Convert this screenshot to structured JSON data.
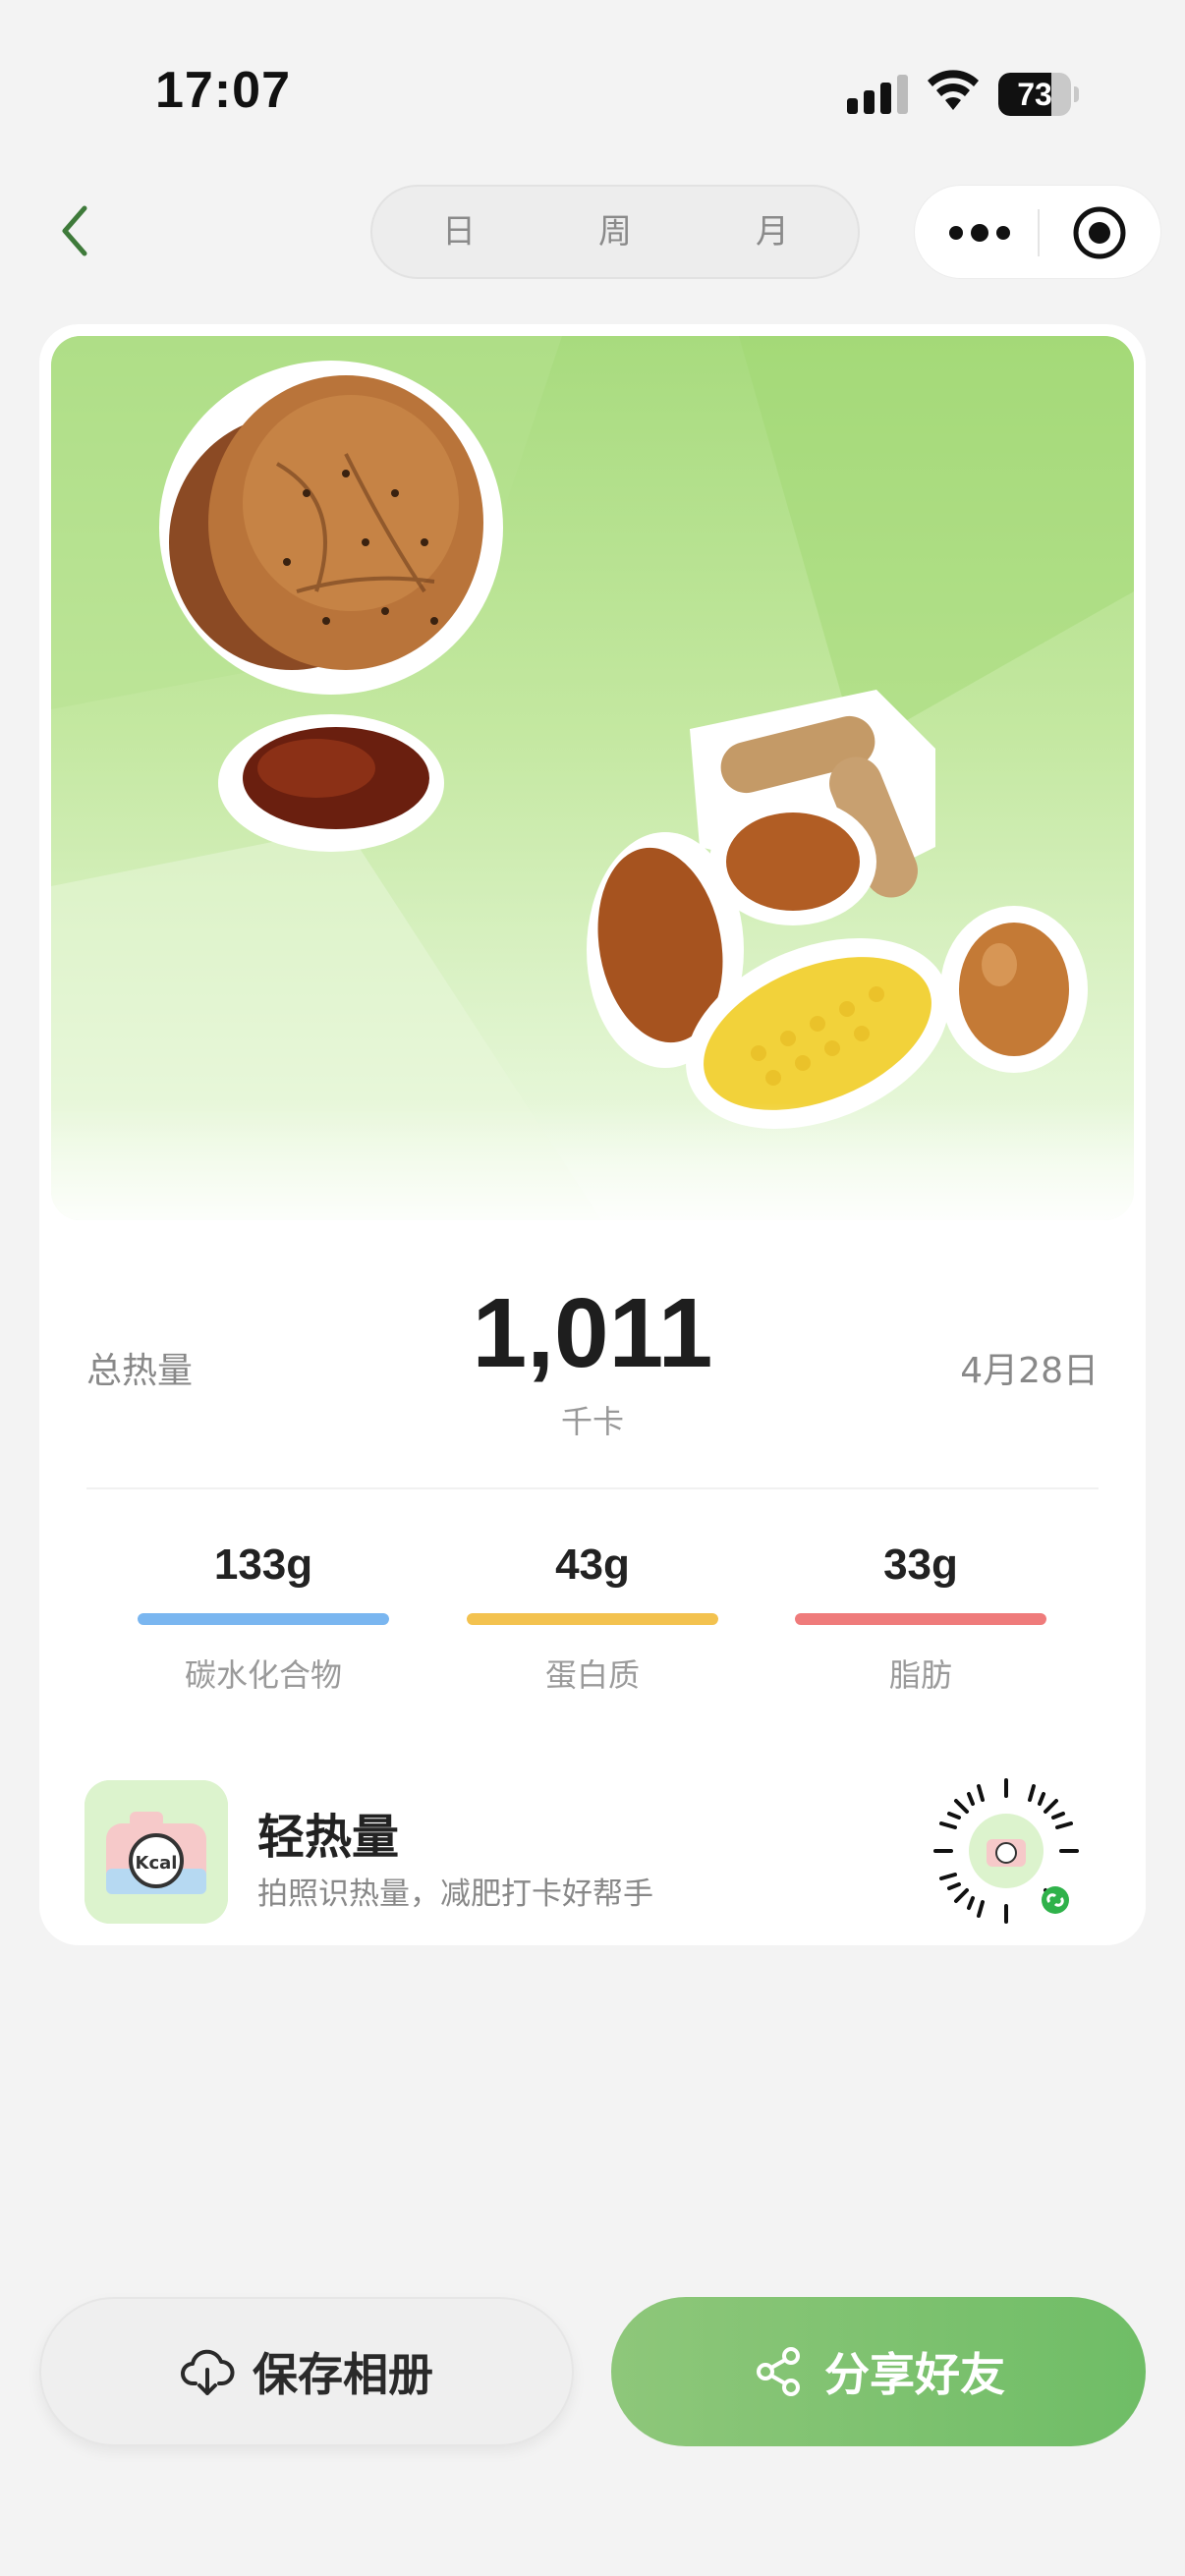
{
  "status_bar": {
    "time": "17:07",
    "battery": "73",
    "battery_level": 0.73
  },
  "nav": {
    "tabs": [
      {
        "label": "日",
        "active": true
      },
      {
        "label": "周",
        "active": false
      },
      {
        "label": "月",
        "active": false
      }
    ]
  },
  "summary": {
    "total_label": "总热量",
    "total_value": "1,011",
    "unit": "千卡",
    "date": "4月28日"
  },
  "macros": [
    {
      "value": "133g",
      "label": "碳水化合物",
      "color": "#7ab6f0"
    },
    {
      "value": "43g",
      "label": "蛋白质",
      "color": "#f3c24f"
    },
    {
      "value": "33g",
      "label": "脂肪",
      "color": "#ef7b7b"
    }
  ],
  "app": {
    "name": "轻热量",
    "tagline": "拍照识热量，减肥打卡好帮手",
    "logo_text": "Kcal"
  },
  "actions": {
    "save_label": "保存相册",
    "share_label": "分享好友"
  },
  "colors": {
    "accent": "#6fbd66",
    "back": "#3e7a3a"
  }
}
